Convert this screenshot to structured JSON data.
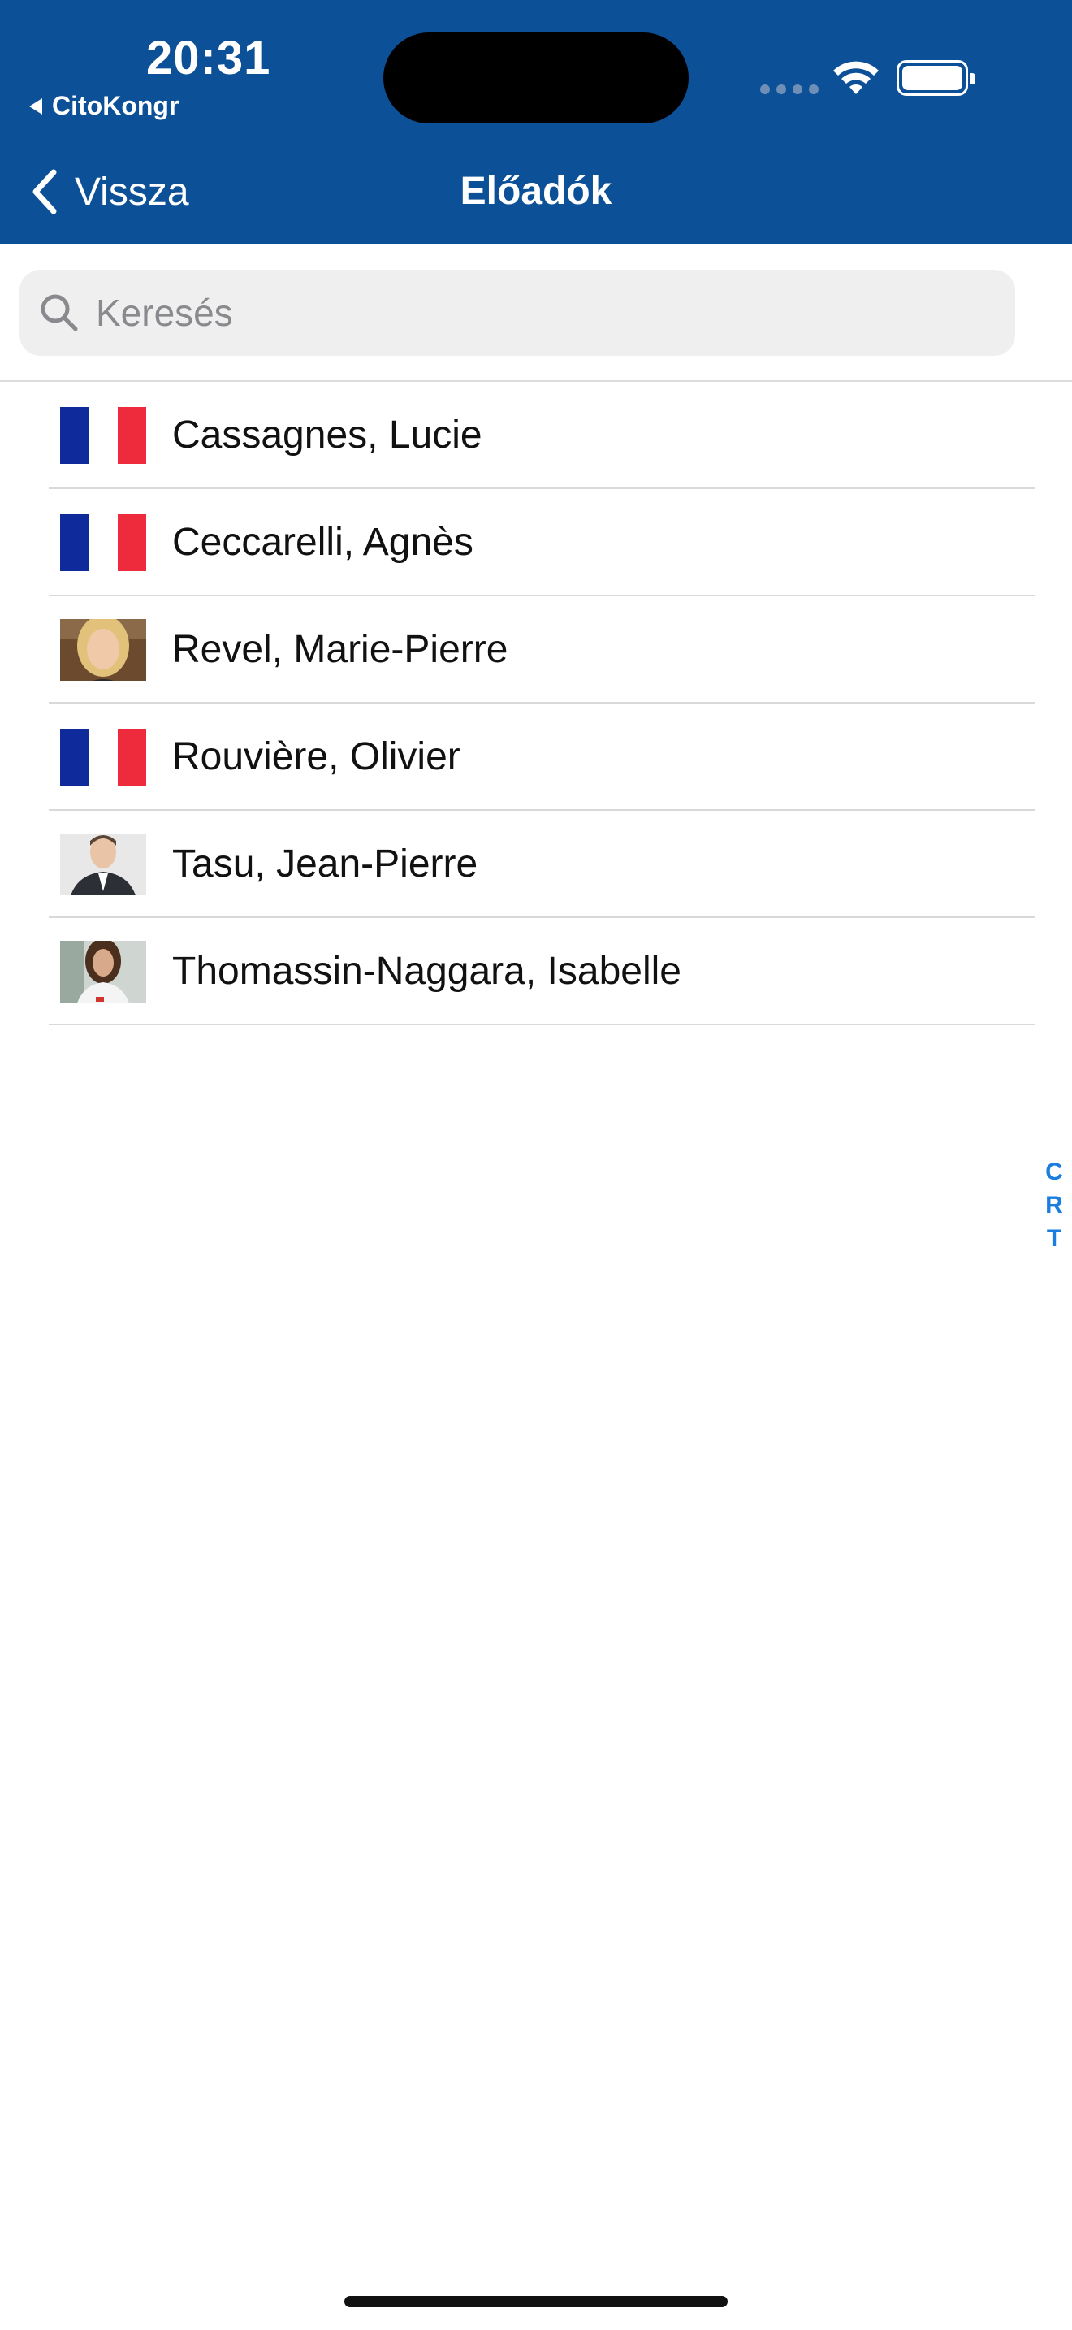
{
  "status_bar": {
    "time": "20:31",
    "back_app": "CitoKongr"
  },
  "nav": {
    "back_label": "Vissza",
    "title": "Előadók"
  },
  "search": {
    "placeholder": "Keresés"
  },
  "speakers": [
    {
      "name": "Cassagnes, Lucie",
      "thumb": "france-flag"
    },
    {
      "name": "Ceccarelli, Agnès",
      "thumb": "france-flag"
    },
    {
      "name": "Revel, Marie-Pierre",
      "thumb": "portrait-photo"
    },
    {
      "name": "Rouvière, Olivier",
      "thumb": "france-flag"
    },
    {
      "name": "Tasu, Jean-Pierre",
      "thumb": "portrait-photo"
    },
    {
      "name": "Thomassin-Naggara, Isabelle",
      "thumb": "portrait-photo"
    }
  ],
  "index_letters": [
    "C",
    "R",
    "T"
  ],
  "colors": {
    "header": "#0c5097",
    "index": "#1a7de0"
  }
}
